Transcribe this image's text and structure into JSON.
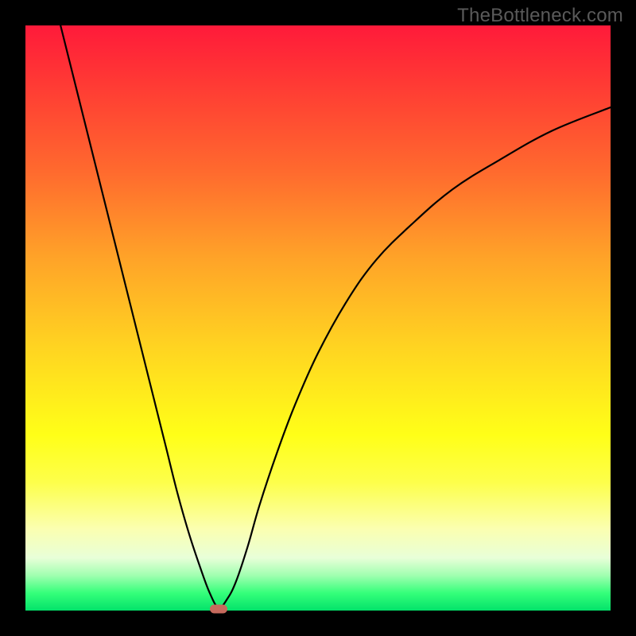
{
  "watermark": "TheBottleneck.com",
  "chart_data": {
    "type": "line",
    "title": "",
    "xlabel": "",
    "ylabel": "",
    "xlim": [
      0,
      100
    ],
    "ylim": [
      0,
      100
    ],
    "grid": false,
    "legend": false,
    "series": [
      {
        "name": "bottleneck-curve",
        "x": [
          6,
          8,
          10,
          12,
          14,
          16,
          18,
          20,
          22,
          24,
          26,
          28,
          30,
          31.5,
          33,
          34.5,
          36,
          38,
          40,
          43,
          46,
          50,
          55,
          60,
          66,
          73,
          81,
          90,
          100
        ],
        "y": [
          100,
          92,
          84,
          76,
          68,
          60,
          52,
          44,
          36,
          28,
          20,
          13,
          7,
          3,
          0.5,
          2,
          5,
          11,
          18,
          27,
          35,
          44,
          53,
          60,
          66,
          72,
          77,
          82,
          86
        ]
      }
    ],
    "marker": {
      "x": 33,
      "y": 0.3,
      "shape": "rounded-rect",
      "color": "#c66a5d"
    },
    "gradient_stops": [
      {
        "pct": 0,
        "color": "#ff1a3a"
      },
      {
        "pct": 25,
        "color": "#ff6a2e"
      },
      {
        "pct": 55,
        "color": "#ffd421"
      },
      {
        "pct": 78,
        "color": "#fdff4a"
      },
      {
        "pct": 94,
        "color": "#a0ffb0"
      },
      {
        "pct": 100,
        "color": "#03e26a"
      }
    ]
  }
}
